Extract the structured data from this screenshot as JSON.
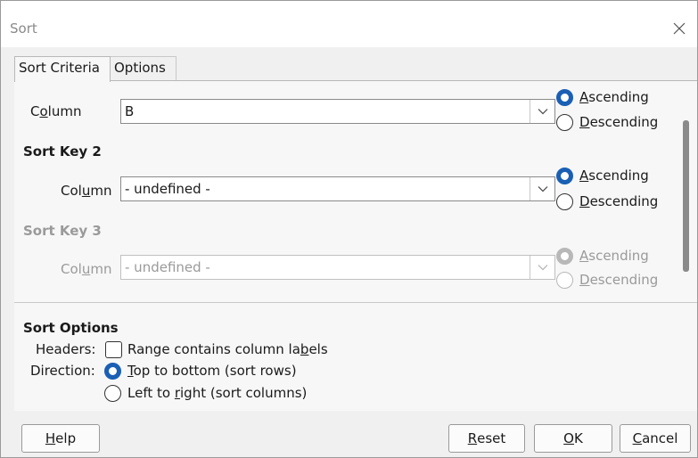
{
  "window": {
    "title": "Sort"
  },
  "tabs": [
    {
      "label": "Sort Criteria",
      "active": true
    },
    {
      "label": "Options",
      "active": false
    }
  ],
  "sort_key_1": {
    "column_label_pre": "C",
    "column_label_acc": "o",
    "column_label_post": "lumn",
    "column_value": "B",
    "ascending": {
      "acc": "A",
      "rest": "scending",
      "checked": true
    },
    "descending": {
      "acc": "D",
      "rest": "escending",
      "checked": false
    }
  },
  "sort_key_2": {
    "heading": "Sort Key 2",
    "column_label_pre": "Col",
    "column_label_acc": "u",
    "column_label_post": "mn",
    "column_value": "- undefined -",
    "ascending": {
      "acc": "A",
      "rest": "scending",
      "checked": true
    },
    "descending": {
      "acc": "D",
      "rest": "escending",
      "checked": false
    }
  },
  "sort_key_3": {
    "heading": "Sort Key 3",
    "column_label_pre": "Col",
    "column_label_acc": "u",
    "column_label_post": "mn",
    "column_value": "- undefined -",
    "ascending": {
      "acc": "A",
      "rest": "scending",
      "checked": true
    },
    "descending": {
      "acc": "D",
      "rest": "escending",
      "checked": false
    },
    "enabled": false
  },
  "sort_options": {
    "heading": "Sort Options",
    "headers_label": "Headers:",
    "headers_checkbox": {
      "pre": "Range contains column la",
      "acc": "b",
      "post": "els",
      "checked": false
    },
    "direction_label": "Direction:",
    "top_to_bottom": {
      "acc": "T",
      "rest": "op to bottom (sort rows)",
      "checked": true
    },
    "left_to_right": {
      "pre": "Left to ",
      "acc": "r",
      "post": "ight (sort columns)",
      "checked": false
    }
  },
  "buttons": {
    "help": {
      "acc": "H",
      "rest": "elp"
    },
    "reset": {
      "acc": "R",
      "rest": "eset"
    },
    "ok": {
      "acc": "O",
      "rest": "K"
    },
    "cancel": {
      "acc": "C",
      "rest": "ancel"
    }
  },
  "colors": {
    "accent": "#1a5fb4",
    "disabled": "#9a9a9a",
    "panel": "#f7f7f7"
  },
  "icons": {
    "close": "close-icon",
    "dropdown": "chevron-down-icon"
  }
}
